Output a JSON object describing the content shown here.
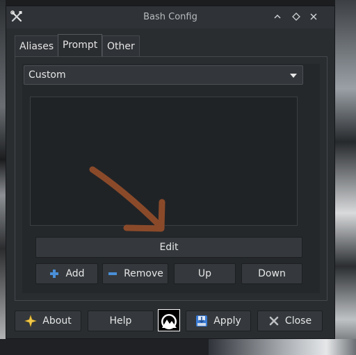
{
  "window": {
    "title": "Bash Config"
  },
  "tabs": [
    {
      "label": "Aliases",
      "active": false
    },
    {
      "label": "Prompt",
      "active": true
    },
    {
      "label": "Other",
      "active": false
    }
  ],
  "prompt": {
    "selected_style": "Custom",
    "edit_label": "Edit",
    "add_label": "Add",
    "remove_label": "Remove",
    "up_label": "Up",
    "down_label": "Down"
  },
  "footer": {
    "about_label": "About",
    "help_label": "Help",
    "apply_label": "Apply",
    "close_label": "Close"
  },
  "colors": {
    "background": "#2a2d30",
    "annotation_arrow": "#8a4a2a",
    "add_icon": "#4a8fd8",
    "remove_icon": "#4a8fd8"
  }
}
